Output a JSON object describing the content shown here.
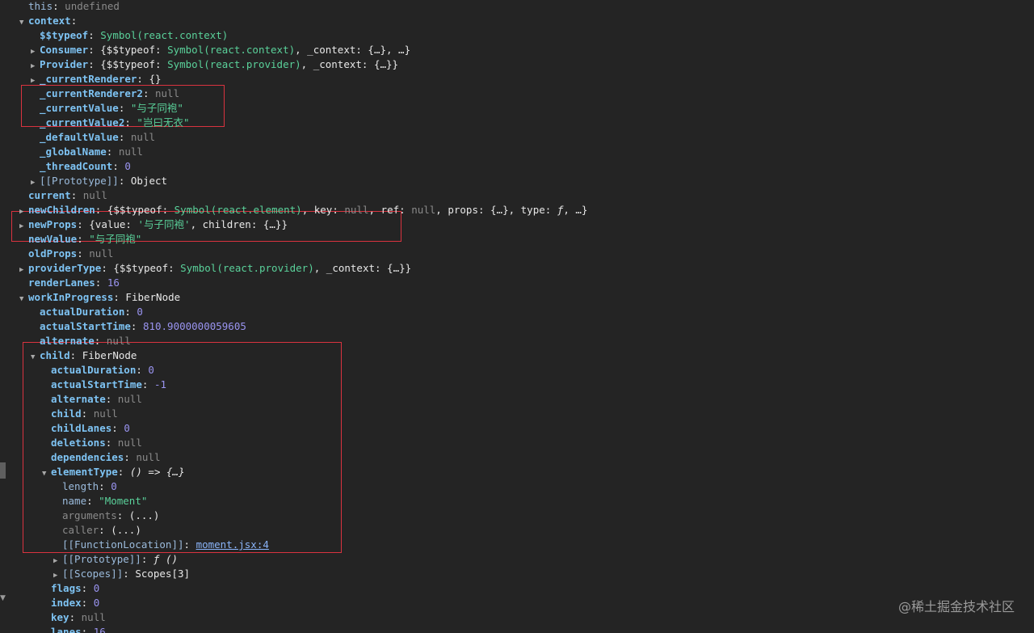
{
  "rows": [
    {
      "depth": 1,
      "arrow": "",
      "key": "this",
      "own": false,
      "sep": ": ",
      "val": [
        {
          "t": "null",
          "s": "undefined"
        }
      ]
    },
    {
      "depth": 1,
      "arrow": "open",
      "key": "context",
      "own": true,
      "sep": ":",
      "val": []
    },
    {
      "depth": 2,
      "arrow": "",
      "key": "$$typeof",
      "own": true,
      "sep": ": ",
      "val": [
        {
          "t": "sym",
          "s": "Symbol(react.context)"
        }
      ]
    },
    {
      "depth": 2,
      "arrow": "closed",
      "key": "Consumer",
      "own": true,
      "sep": ": ",
      "val": [
        {
          "t": "obj",
          "s": "{$$typeof: "
        },
        {
          "t": "sym",
          "s": "Symbol(react.context)"
        },
        {
          "t": "obj",
          "s": ", _context: {…}, …}"
        }
      ]
    },
    {
      "depth": 2,
      "arrow": "closed",
      "key": "Provider",
      "own": true,
      "sep": ": ",
      "val": [
        {
          "t": "obj",
          "s": "{$$typeof: "
        },
        {
          "t": "sym",
          "s": "Symbol(react.provider)"
        },
        {
          "t": "obj",
          "s": ", _context: {…}}"
        }
      ]
    },
    {
      "depth": 2,
      "arrow": "closed",
      "key": "_currentRenderer",
      "own": true,
      "sep": ": ",
      "val": [
        {
          "t": "obj",
          "s": "{}"
        }
      ]
    },
    {
      "depth": 2,
      "arrow": "",
      "key": "_currentRenderer2",
      "own": true,
      "sep": ": ",
      "val": [
        {
          "t": "null",
          "s": "null"
        }
      ]
    },
    {
      "depth": 2,
      "arrow": "",
      "key": "_currentValue",
      "own": true,
      "sep": ": ",
      "val": [
        {
          "t": "str",
          "s": "\"与子同袍\""
        }
      ]
    },
    {
      "depth": 2,
      "arrow": "",
      "key": "_currentValue2",
      "own": true,
      "sep": ": ",
      "val": [
        {
          "t": "str",
          "s": "\"岂曰无衣\""
        }
      ]
    },
    {
      "depth": 2,
      "arrow": "",
      "key": "_defaultValue",
      "own": true,
      "sep": ": ",
      "val": [
        {
          "t": "null",
          "s": "null"
        }
      ]
    },
    {
      "depth": 2,
      "arrow": "",
      "key": "_globalName",
      "own": true,
      "sep": ": ",
      "val": [
        {
          "t": "null",
          "s": "null"
        }
      ]
    },
    {
      "depth": 2,
      "arrow": "",
      "key": "_threadCount",
      "own": true,
      "sep": ": ",
      "val": [
        {
          "t": "num",
          "s": "0"
        }
      ]
    },
    {
      "depth": 2,
      "arrow": "closed",
      "key": "[[Prototype]]",
      "own": false,
      "sep": ": ",
      "val": [
        {
          "t": "obj",
          "s": "Object"
        }
      ]
    },
    {
      "depth": 1,
      "arrow": "",
      "key": "current",
      "own": true,
      "sep": ": ",
      "val": [
        {
          "t": "null",
          "s": "null"
        }
      ]
    },
    {
      "depth": 1,
      "arrow": "closed",
      "key": "newChildren",
      "own": true,
      "sep": ": ",
      "val": [
        {
          "t": "obj",
          "s": "{$$typeof: "
        },
        {
          "t": "sym",
          "s": "Symbol(react.element)"
        },
        {
          "t": "obj",
          "s": ", key: "
        },
        {
          "t": "null",
          "s": "null"
        },
        {
          "t": "obj",
          "s": ", ref: "
        },
        {
          "t": "null",
          "s": "null"
        },
        {
          "t": "obj",
          "s": ", props: {…}, type: "
        },
        {
          "t": "fn",
          "s": "ƒ"
        },
        {
          "t": "obj",
          "s": ", …}"
        }
      ]
    },
    {
      "depth": 1,
      "arrow": "closed",
      "key": "newProps",
      "own": true,
      "sep": ": ",
      "val": [
        {
          "t": "obj",
          "s": "{value: "
        },
        {
          "t": "str",
          "s": "'与子同袍'"
        },
        {
          "t": "obj",
          "s": ", children: {…}}"
        }
      ]
    },
    {
      "depth": 1,
      "arrow": "",
      "key": "newValue",
      "own": true,
      "sep": ": ",
      "val": [
        {
          "t": "str",
          "s": "\"与子同袍\""
        }
      ]
    },
    {
      "depth": 1,
      "arrow": "",
      "key": "oldProps",
      "own": true,
      "sep": ": ",
      "val": [
        {
          "t": "null",
          "s": "null"
        }
      ]
    },
    {
      "depth": 1,
      "arrow": "closed",
      "key": "providerType",
      "own": true,
      "sep": ": ",
      "val": [
        {
          "t": "obj",
          "s": "{$$typeof: "
        },
        {
          "t": "sym",
          "s": "Symbol(react.provider)"
        },
        {
          "t": "obj",
          "s": ", _context: {…}}"
        }
      ]
    },
    {
      "depth": 1,
      "arrow": "",
      "key": "renderLanes",
      "own": true,
      "sep": ": ",
      "val": [
        {
          "t": "num",
          "s": "16"
        }
      ]
    },
    {
      "depth": 1,
      "arrow": "open",
      "key": "workInProgress",
      "own": true,
      "sep": ": ",
      "val": [
        {
          "t": "obj",
          "s": "FiberNode"
        }
      ]
    },
    {
      "depth": 2,
      "arrow": "",
      "key": "actualDuration",
      "own": true,
      "sep": ": ",
      "val": [
        {
          "t": "num",
          "s": "0"
        }
      ]
    },
    {
      "depth": 2,
      "arrow": "",
      "key": "actualStartTime",
      "own": true,
      "sep": ": ",
      "val": [
        {
          "t": "num",
          "s": "810.9000000059605"
        }
      ]
    },
    {
      "depth": 2,
      "arrow": "",
      "key": "alternate",
      "own": true,
      "sep": ": ",
      "val": [
        {
          "t": "null",
          "s": "null"
        }
      ]
    },
    {
      "depth": 2,
      "arrow": "open",
      "key": "child",
      "own": true,
      "sep": ": ",
      "val": [
        {
          "t": "obj",
          "s": "FiberNode"
        }
      ]
    },
    {
      "depth": 3,
      "arrow": "",
      "key": "actualDuration",
      "own": true,
      "sep": ": ",
      "val": [
        {
          "t": "num",
          "s": "0"
        }
      ]
    },
    {
      "depth": 3,
      "arrow": "",
      "key": "actualStartTime",
      "own": true,
      "sep": ": ",
      "val": [
        {
          "t": "num",
          "s": "-1"
        }
      ]
    },
    {
      "depth": 3,
      "arrow": "",
      "key": "alternate",
      "own": true,
      "sep": ": ",
      "val": [
        {
          "t": "null",
          "s": "null"
        }
      ]
    },
    {
      "depth": 3,
      "arrow": "",
      "key": "child",
      "own": true,
      "sep": ": ",
      "val": [
        {
          "t": "null",
          "s": "null"
        }
      ]
    },
    {
      "depth": 3,
      "arrow": "",
      "key": "childLanes",
      "own": true,
      "sep": ": ",
      "val": [
        {
          "t": "num",
          "s": "0"
        }
      ]
    },
    {
      "depth": 3,
      "arrow": "",
      "key": "deletions",
      "own": true,
      "sep": ": ",
      "val": [
        {
          "t": "null",
          "s": "null"
        }
      ]
    },
    {
      "depth": 3,
      "arrow": "",
      "key": "dependencies",
      "own": true,
      "sep": ": ",
      "val": [
        {
          "t": "null",
          "s": "null"
        }
      ]
    },
    {
      "depth": 3,
      "arrow": "open",
      "key": "elementType",
      "own": true,
      "sep": ": ",
      "val": [
        {
          "t": "fn",
          "s": "() => {…}"
        }
      ]
    },
    {
      "depth": 4,
      "arrow": "",
      "key": "length",
      "own": false,
      "sep": ": ",
      "val": [
        {
          "t": "num",
          "s": "0"
        }
      ]
    },
    {
      "depth": 4,
      "arrow": "",
      "key": "name",
      "own": false,
      "sep": ": ",
      "val": [
        {
          "t": "str",
          "s": "\"Moment\""
        }
      ]
    },
    {
      "depth": 4,
      "arrow": "",
      "key": "arguments",
      "own": false,
      "dim": true,
      "sep": ": ",
      "val": [
        {
          "t": "obj",
          "s": "(...)"
        }
      ]
    },
    {
      "depth": 4,
      "arrow": "",
      "key": "caller",
      "own": false,
      "dim": true,
      "sep": ": ",
      "val": [
        {
          "t": "obj",
          "s": "(...)"
        }
      ]
    },
    {
      "depth": 4,
      "arrow": "",
      "key": "[[FunctionLocation]]",
      "own": false,
      "sep": ": ",
      "val": [
        {
          "t": "link",
          "s": "moment.jsx:4"
        }
      ]
    },
    {
      "depth": 4,
      "arrow": "closed",
      "key": "[[Prototype]]",
      "own": false,
      "sep": ": ",
      "val": [
        {
          "t": "fn",
          "s": "ƒ ()"
        }
      ]
    },
    {
      "depth": 4,
      "arrow": "closed",
      "key": "[[Scopes]]",
      "own": false,
      "sep": ": ",
      "val": [
        {
          "t": "obj",
          "s": "Scopes[3]"
        }
      ]
    },
    {
      "depth": 3,
      "arrow": "",
      "key": "flags",
      "own": true,
      "sep": ": ",
      "val": [
        {
          "t": "num",
          "s": "0"
        }
      ]
    },
    {
      "depth": 3,
      "arrow": "",
      "key": "index",
      "own": true,
      "sep": ": ",
      "val": [
        {
          "t": "num",
          "s": "0"
        }
      ]
    },
    {
      "depth": 3,
      "arrow": "",
      "key": "key",
      "own": true,
      "sep": ": ",
      "val": [
        {
          "t": "null",
          "s": "null"
        }
      ]
    },
    {
      "depth": 3,
      "arrow": "",
      "key": "lanes",
      "own": true,
      "sep": ": ",
      "val": [
        {
          "t": "num",
          "s": "16"
        }
      ]
    }
  ],
  "colors": {
    "background": "#242424",
    "key": "#7ec3f3",
    "string": "#5ad19a",
    "number": "#9a94f0",
    "null": "#8a8a8a",
    "highlight": "#d9333f"
  },
  "watermark": "@稀土掘金技术社区"
}
